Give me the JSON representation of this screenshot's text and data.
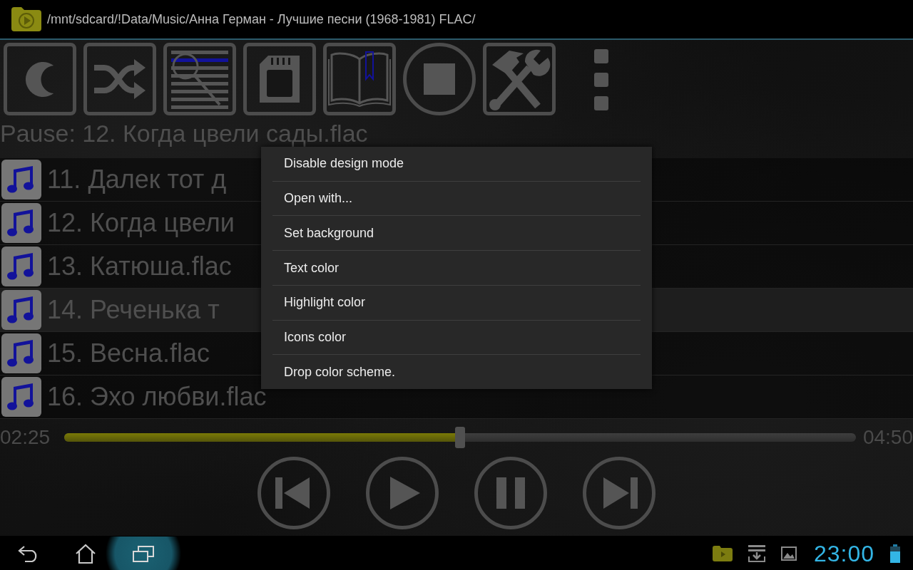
{
  "title_bar": {
    "path": "/mnt/sdcard/!Data/Music/Анна Герман - Лучшие песни (1968-1981) FLAC/"
  },
  "now_playing": {
    "text": "Pause: 12. Когда цвели сады.flac"
  },
  "tracks": [
    {
      "title": "11. Далек тот д",
      "selected": false
    },
    {
      "title": "12. Когда цвели",
      "selected": false
    },
    {
      "title": "13. Катюша.flac",
      "selected": false
    },
    {
      "title": "14. Реченька т",
      "selected": true
    },
    {
      "title": "15. Весна.flac",
      "selected": false
    },
    {
      "title": "16. Эхо любви.flac",
      "selected": false
    }
  ],
  "context_menu": {
    "items": [
      "Disable design mode",
      "Open with...",
      "Set background",
      "Text color",
      "Highlight color",
      "Icons color",
      "Drop color scheme."
    ]
  },
  "seek_bar": {
    "elapsed": "02:25",
    "level": 0.5,
    "total": "04:50"
  },
  "navigation_bar": {
    "recent_apps_pressed": true,
    "clock": "23:00"
  }
}
